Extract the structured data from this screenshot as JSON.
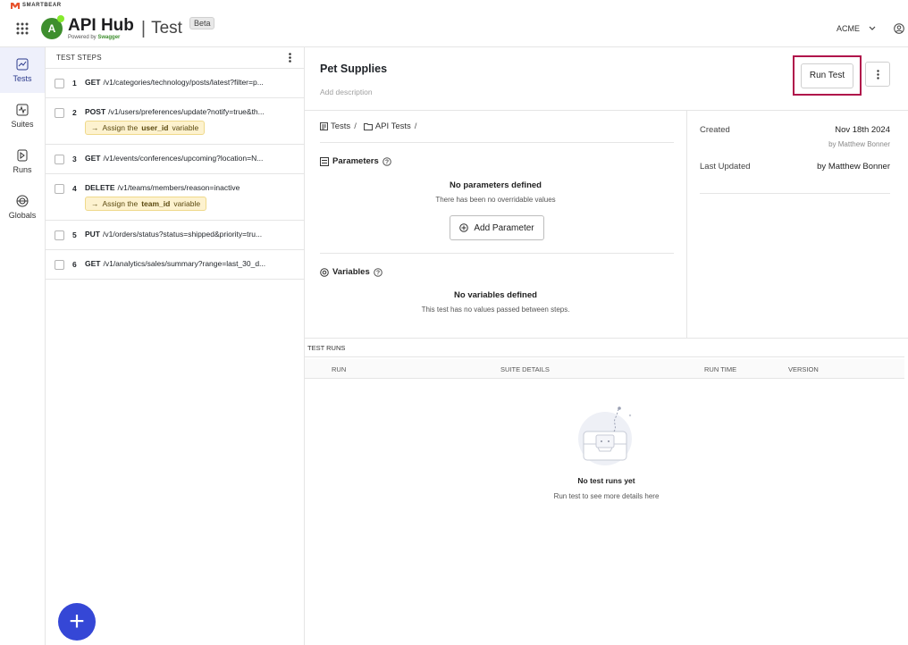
{
  "brand": {
    "company": "SMARTBEAR"
  },
  "header": {
    "logo_letter": "A",
    "app_name": "API Hub",
    "powered_prefix": "Powered by",
    "powered_brand": "Swagger",
    "separator": "|",
    "product": "Test",
    "badge": "Beta",
    "org": "ACME"
  },
  "nav": {
    "items": [
      {
        "label": "Tests",
        "icon": "chart-icon",
        "active": true
      },
      {
        "label": "Suites",
        "icon": "suites-icon",
        "active": false
      },
      {
        "label": "Runs",
        "icon": "runs-icon",
        "active": false
      },
      {
        "label": "Globals",
        "icon": "globe-icon",
        "active": false
      }
    ]
  },
  "steps": {
    "header": "TEST STEPS",
    "items": [
      {
        "num": "1",
        "method": "GET",
        "path": "/v1/categories/technology/posts/latest?filter=p..."
      },
      {
        "num": "2",
        "method": "POST",
        "path": "/v1/users/preferences/update?notify=true&th...",
        "assign": {
          "arrow": "→",
          "prefix": "Assign the",
          "var": "user_id",
          "suffix": "variable"
        }
      },
      {
        "num": "3",
        "method": "GET",
        "path": "/v1/events/conferences/upcoming?location=N..."
      },
      {
        "num": "4",
        "method": "DELETE",
        "path": "/v1/teams/members/reason=inactive",
        "assign": {
          "arrow": "→",
          "prefix": "Assign the",
          "var": "team_id",
          "suffix": "variable"
        }
      },
      {
        "num": "5",
        "method": "PUT",
        "path": "/v1/orders/status?status=shipped&priority=tru..."
      },
      {
        "num": "6",
        "method": "GET",
        "path": "/v1/analytics/sales/summary?range=last_30_d..."
      }
    ],
    "fab": "+"
  },
  "main": {
    "title": "Pet Supplies",
    "add_description": "Add description",
    "run_test": "Run Test",
    "breadcrumb": [
      {
        "label": "Tests"
      },
      {
        "label": "API Tests"
      }
    ],
    "breadcrumb_sep": "/",
    "parameters": {
      "heading": "Parameters",
      "empty_title": "No parameters defined",
      "empty_sub": "There has been no overridable values",
      "add_button": "Add Parameter"
    },
    "variables": {
      "heading": "Variables",
      "empty_title": "No variables defined",
      "empty_sub": "This test has no values passed between steps."
    },
    "meta": {
      "created_label": "Created",
      "created_value": "Nov 18th 2024",
      "created_by": "by Matthew Bonner",
      "updated_label": "Last Updated",
      "updated_value": "by Matthew Bonner"
    }
  },
  "runs": {
    "header": "TEST RUNS",
    "columns": [
      "RUN",
      "SUITE DETAILS",
      "RUN TIME",
      "VERSION"
    ],
    "empty_title": "No test runs yet",
    "empty_sub": "Run test to see more details here"
  },
  "colors": {
    "accent": "#3547d6",
    "highlight_border": "#b0124a",
    "swagger_green": "#3e8e2e",
    "pill_bg": "#fdf2cf"
  }
}
